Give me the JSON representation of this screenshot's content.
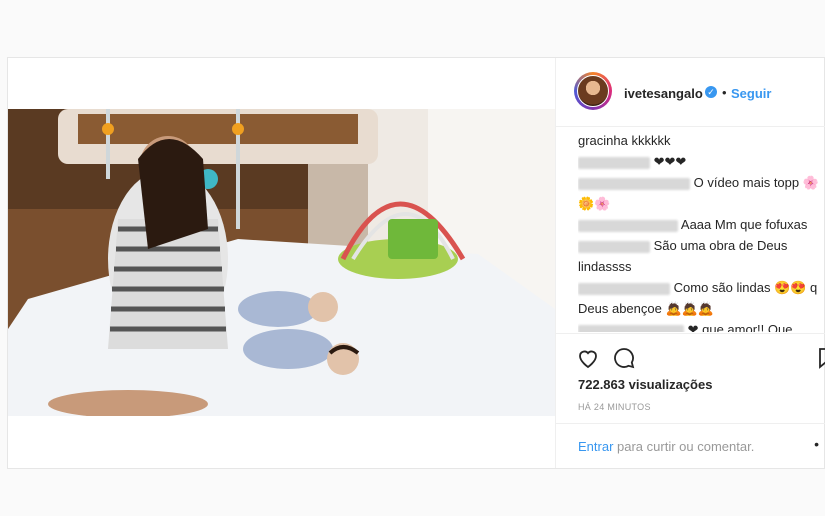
{
  "post": {
    "username": "ivetesangalo",
    "follow_label": "Seguir",
    "separator": "•",
    "views": "722.863 visualizações",
    "time_ago": "HÁ 24 MINUTOS",
    "login_link": "Entrar",
    "login_suffix": " para curtir ou comentar.",
    "more": "•"
  },
  "comments": [
    {
      "user": "",
      "text": "gracinha kkkkkk"
    },
    {
      "user": "",
      "text": "❤❤❤"
    },
    {
      "user": "",
      "text": "O vídeo mais topp 🌸"
    },
    {
      "user": "",
      "text": "🌼🌸"
    },
    {
      "user": "",
      "text": "Aaaa Mm que fofuxas"
    },
    {
      "user": "",
      "text": "São uma obra de Deus"
    },
    {
      "user": "",
      "text": "lindassss"
    },
    {
      "user": "",
      "text": "Como são lindas 😍😍 q"
    },
    {
      "user": "",
      "text": "Deus abençoe 🙇🙇🙇"
    },
    {
      "user": "",
      "text": "❤ que amor!! Que"
    }
  ],
  "icons": {
    "heart": "heart-icon",
    "comment": "comment-icon",
    "bookmark": "bookmark-icon",
    "verified": "verified-badge-icon"
  },
  "colors": {
    "accent": "#3897f0",
    "text": "#262626",
    "muted": "#999999"
  }
}
